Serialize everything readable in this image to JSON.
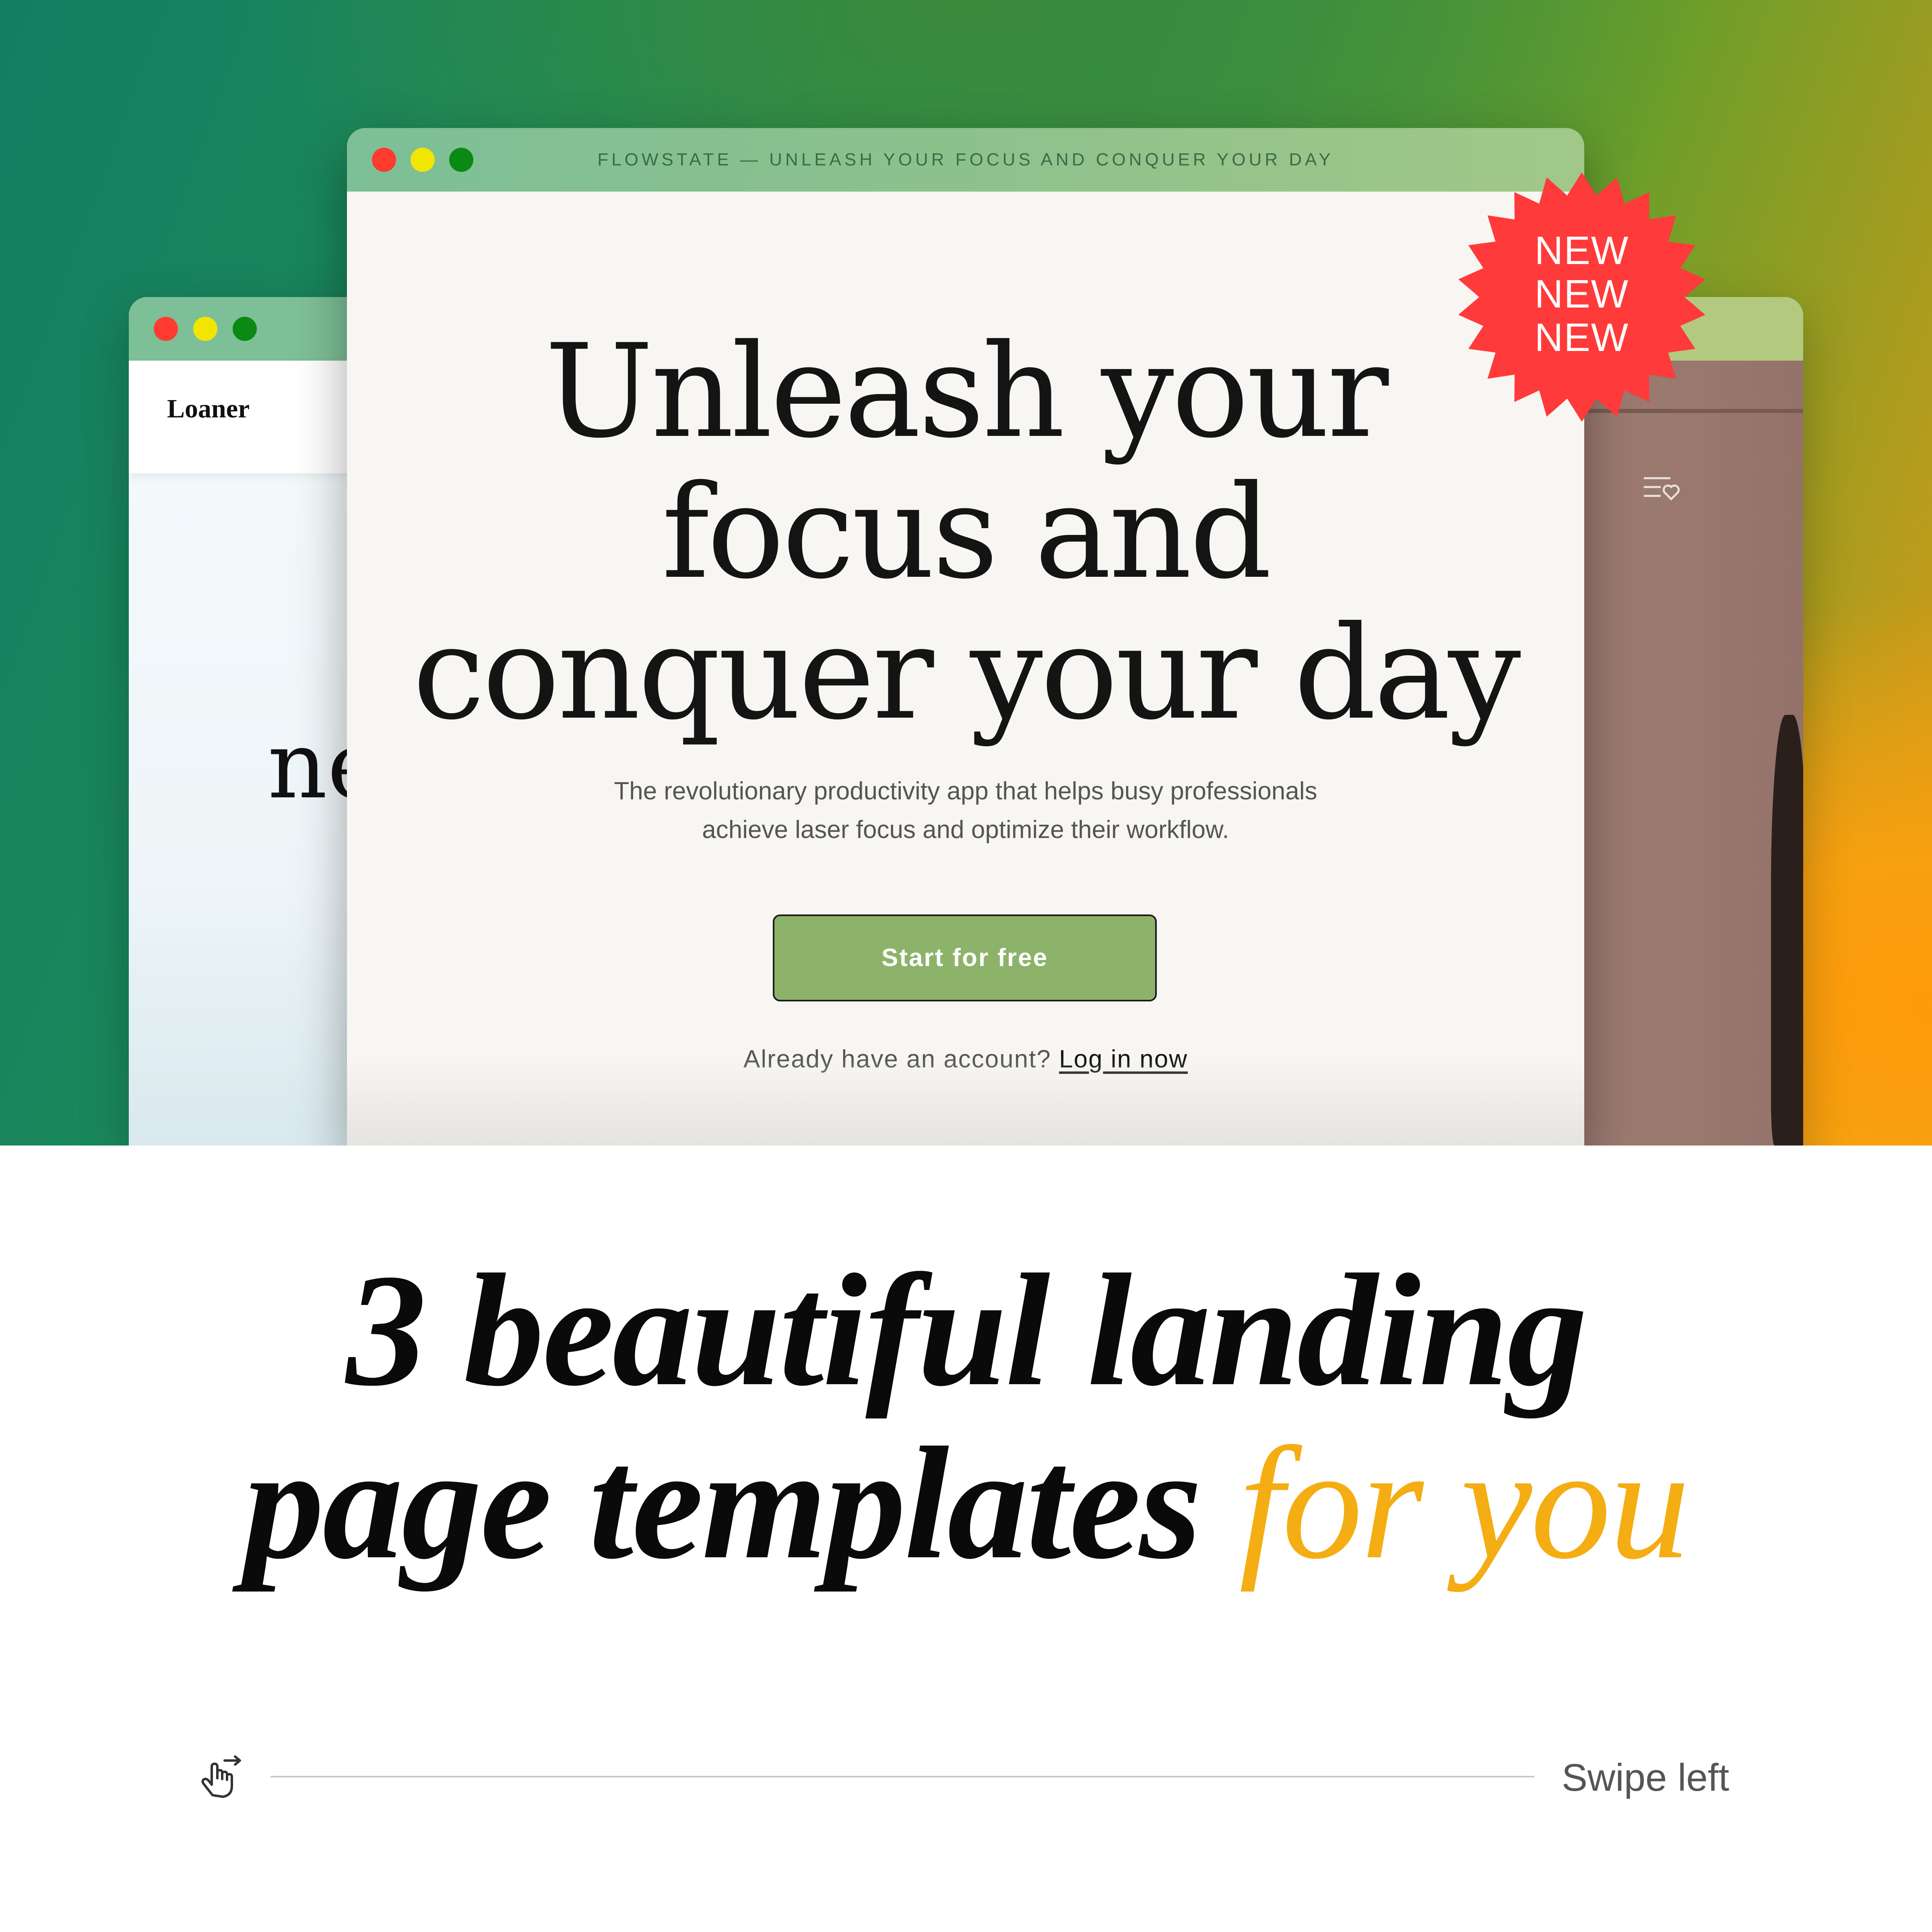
{
  "colors": {
    "dot_red": "#ff3b30",
    "dot_yellow": "#f2e600",
    "dot_green": "#0a8a13",
    "cta_green": "#8db36a",
    "badge_red": "#ff3a3a",
    "accent_yellow": "#f4ad12"
  },
  "window_left": {
    "brand": "Loaner",
    "body_fragment": "ne"
  },
  "window_main": {
    "title": "FLOWSTATE — UNLEASH YOUR FOCUS AND CONQUER YOUR DAY",
    "headline_line1": "Unleash your",
    "headline_line2": "focus and",
    "headline_line3": "conquer your day",
    "subtext_line1": "The revolutionary productivity app that helps busy professionals",
    "subtext_line2": "achieve laser focus and optimize their workflow.",
    "cta_label": "Start for free",
    "login_prompt": "Already have an account?",
    "login_link": "Log in now"
  },
  "window_right": {
    "icon": "menu-heart-icon"
  },
  "badge": {
    "line1": "NEW",
    "line2": "NEW",
    "line3": "NEW"
  },
  "heading": {
    "line1": "3 beautiful landing",
    "line2_main": "page templates",
    "line2_accent": "for you"
  },
  "footer": {
    "icon": "swipe-hand-icon",
    "label": "Swipe left"
  }
}
